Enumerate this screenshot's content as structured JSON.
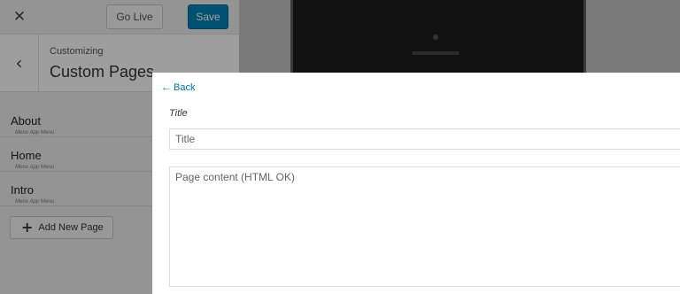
{
  "topbar": {
    "close_icon": "close-icon",
    "go_live_label": "Go Live",
    "save_label": "Save",
    "accent_color": "#0085ba"
  },
  "section": {
    "back_icon": "chevron-left-icon",
    "crumb": "Customizing",
    "title": "Custom Pages"
  },
  "pages": [
    {
      "label": "About",
      "sub": "Menu App Menu"
    },
    {
      "label": "Home",
      "sub": "Menu App Menu"
    },
    {
      "label": "Intro",
      "sub": "Menu App Menu"
    }
  ],
  "add_page": {
    "icon": "plus-icon",
    "label": "Add New Page"
  },
  "panel": {
    "back_link": "← Back",
    "title_label": "Title",
    "title_placeholder": "Title",
    "content_placeholder": "Page content (HTML OK)",
    "link_color": "#0073aa"
  }
}
